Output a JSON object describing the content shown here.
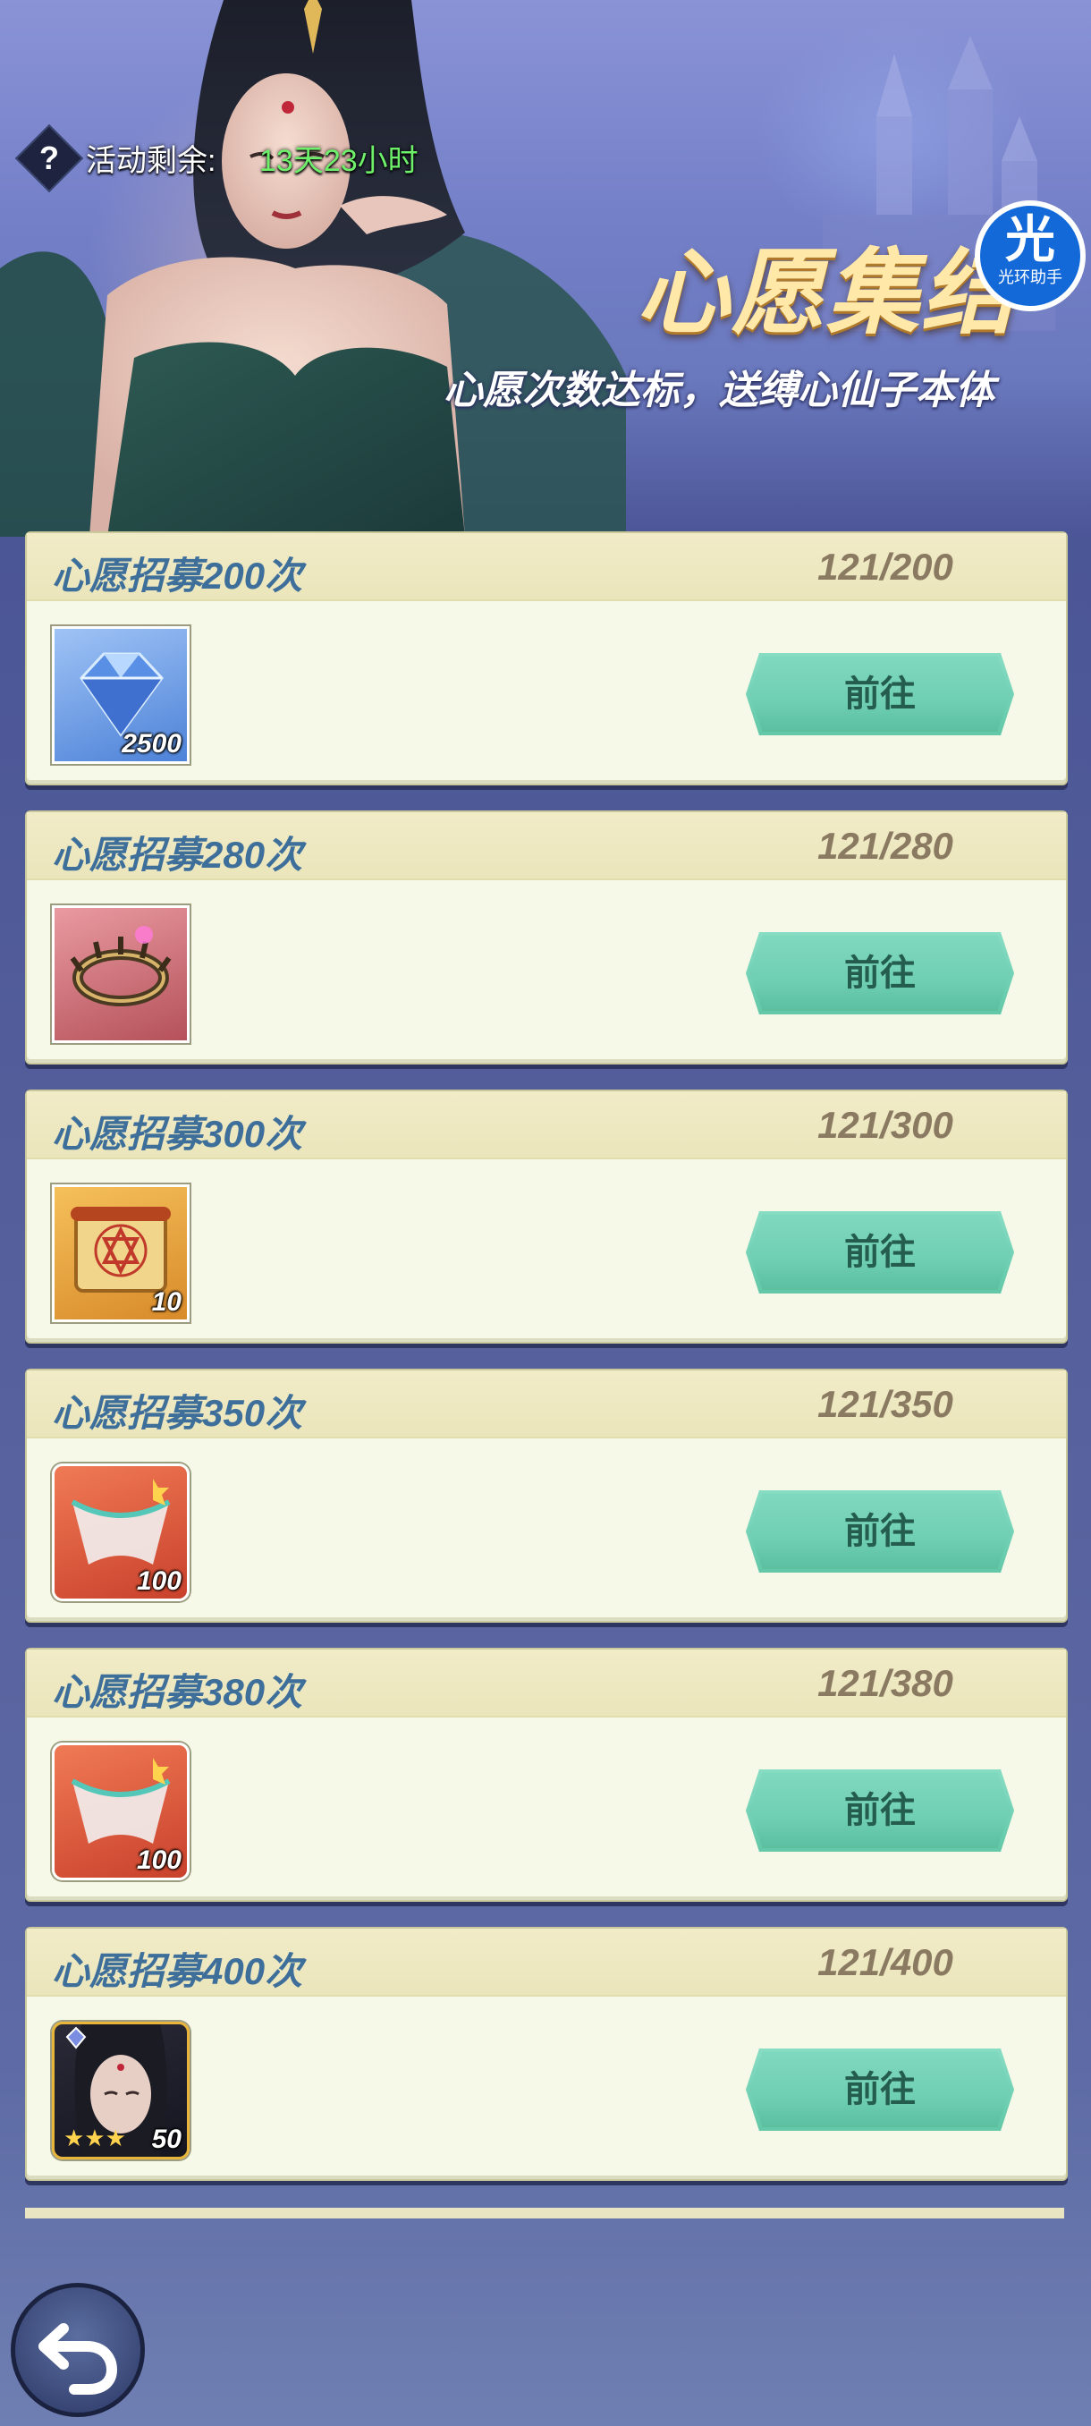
{
  "banner": {
    "remaining_label": "活动剩余:",
    "remaining_value": "13天23小时",
    "title": "心愿集结",
    "subtitle": "心愿次数达标，送缚心仙子本体",
    "badge_top": "光",
    "badge_bottom": "光环助手"
  },
  "tasks": [
    {
      "title": "心愿招募200次",
      "progress": "121/200",
      "reward_icon": "diamond-icon",
      "reward_count": "2500",
      "button": "前往"
    },
    {
      "title": "心愿招募280次",
      "progress": "121/280",
      "reward_icon": "thorn-crown-icon",
      "reward_count": "",
      "button": "前往"
    },
    {
      "title": "心愿招募300次",
      "progress": "121/300",
      "reward_icon": "scroll-icon",
      "reward_count": "10",
      "button": "前往"
    },
    {
      "title": "心愿招募350次",
      "progress": "121/350",
      "reward_icon": "ribbon-shard-icon",
      "reward_count": "100",
      "button": "前往"
    },
    {
      "title": "心愿招募380次",
      "progress": "121/380",
      "reward_icon": "ribbon-shard-icon",
      "reward_count": "100",
      "button": "前往"
    },
    {
      "title": "心愿招募400次",
      "progress": "121/400",
      "reward_icon": "hero-portrait-icon",
      "reward_count": "50",
      "button": "前往"
    }
  ],
  "colors": {
    "accent": "#6fcfb2",
    "title_blue": "#3e6f9b",
    "timer_green": "#6ef06b"
  }
}
